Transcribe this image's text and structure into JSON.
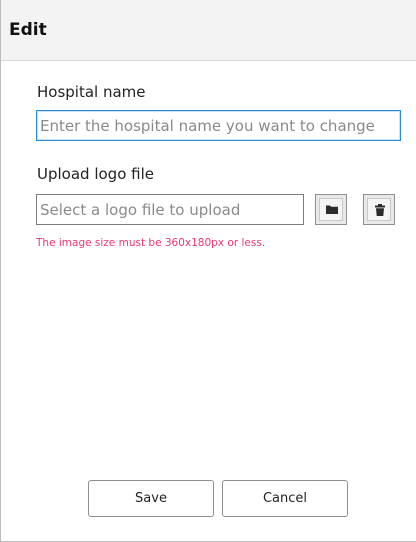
{
  "dialog": {
    "title": "Edit"
  },
  "form": {
    "hospital_name_label": "Hospital name",
    "hospital_name_placeholder": "Enter the hospital name you want to change",
    "hospital_name_value": "",
    "logo_label": "Upload logo file",
    "logo_placeholder": "Select a logo file to upload",
    "logo_value": "",
    "logo_hint": "The image size must be 360x180px or less.",
    "browse_icon": "folder-icon",
    "delete_icon": "trash-icon"
  },
  "footer": {
    "save_label": "Save",
    "cancel_label": "Cancel"
  },
  "colors": {
    "hint": "#e53970",
    "focus_border": "#2a8dd4",
    "title_bar": "#f3f3f3"
  }
}
